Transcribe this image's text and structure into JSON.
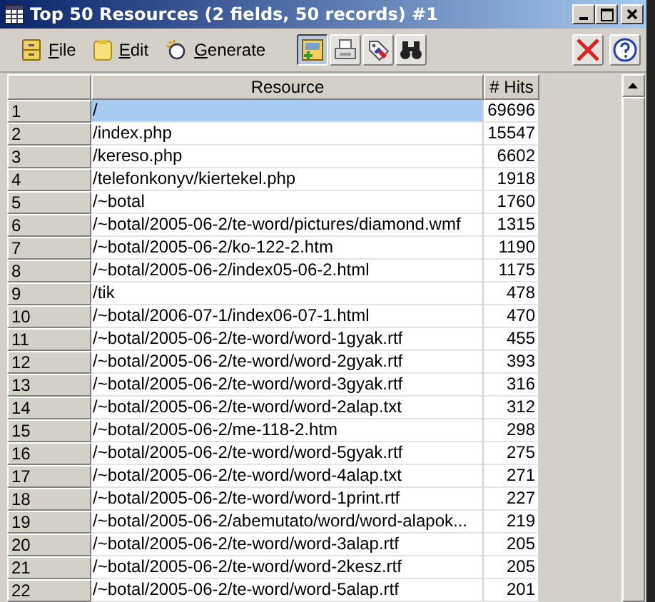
{
  "window": {
    "title": "Top 50 Resources (2 fields, 50 records) #1"
  },
  "menu": [
    {
      "label": "File",
      "kind": "file"
    },
    {
      "label": "Edit",
      "kind": "edit"
    },
    {
      "label": "Generate",
      "kind": "generate"
    }
  ],
  "tools": [
    {
      "kind": "table",
      "selected": true
    },
    {
      "kind": "print",
      "selected": false
    },
    {
      "kind": "tag",
      "selected": false
    },
    {
      "kind": "find",
      "selected": false
    }
  ],
  "table": {
    "columns": [
      "Resource",
      "# Hits"
    ],
    "rows": [
      {
        "index": "1",
        "resource": "/",
        "hits": "69696",
        "selected": true
      },
      {
        "index": "2",
        "resource": "/index.php",
        "hits": "15547",
        "selected": false
      },
      {
        "index": "3",
        "resource": "/kereso.php",
        "hits": "6602",
        "selected": false
      },
      {
        "index": "4",
        "resource": "/telefonkonyv/kiertekel.php",
        "hits": "1918",
        "selected": false
      },
      {
        "index": "5",
        "resource": "/~botal",
        "hits": "1760",
        "selected": false
      },
      {
        "index": "6",
        "resource": "/~botal/2005-06-2/te-word/pictures/diamond.wmf",
        "hits": "1315",
        "selected": false
      },
      {
        "index": "7",
        "resource": "/~botal/2005-06-2/ko-122-2.htm",
        "hits": "1190",
        "selected": false
      },
      {
        "index": "8",
        "resource": "/~botal/2005-06-2/index05-06-2.html",
        "hits": "1175",
        "selected": false
      },
      {
        "index": "9",
        "resource": "/tik",
        "hits": "478",
        "selected": false
      },
      {
        "index": "10",
        "resource": "/~botal/2006-07-1/index06-07-1.html",
        "hits": "470",
        "selected": false
      },
      {
        "index": "11",
        "resource": "/~botal/2005-06-2/te-word/word-1gyak.rtf",
        "hits": "455",
        "selected": false
      },
      {
        "index": "12",
        "resource": "/~botal/2005-06-2/te-word/word-2gyak.rtf",
        "hits": "393",
        "selected": false
      },
      {
        "index": "13",
        "resource": "/~botal/2005-06-2/te-word/word-3gyak.rtf",
        "hits": "316",
        "selected": false
      },
      {
        "index": "14",
        "resource": "/~botal/2005-06-2/te-word/word-2alap.txt",
        "hits": "312",
        "selected": false
      },
      {
        "index": "15",
        "resource": "/~botal/2005-06-2/me-118-2.htm",
        "hits": "298",
        "selected": false
      },
      {
        "index": "16",
        "resource": "/~botal/2005-06-2/te-word/word-5gyak.rtf",
        "hits": "275",
        "selected": false
      },
      {
        "index": "17",
        "resource": "/~botal/2005-06-2/te-word/word-4alap.txt",
        "hits": "271",
        "selected": false
      },
      {
        "index": "18",
        "resource": "/~botal/2005-06-2/te-word/word-1print.rtf",
        "hits": "227",
        "selected": false
      },
      {
        "index": "19",
        "resource": "/~botal/2005-06-2/abemutato/word/word-alapok...",
        "hits": "219",
        "selected": false
      },
      {
        "index": "20",
        "resource": "/~botal/2005-06-2/te-word/word-3alap.rtf",
        "hits": "205",
        "selected": false
      },
      {
        "index": "21",
        "resource": "/~botal/2005-06-2/te-word/word-2kesz.rtf",
        "hits": "205",
        "selected": false
      },
      {
        "index": "22",
        "resource": "/~botal/2005-06-2/te-word/word-5alap.rtf",
        "hits": "201",
        "selected": false
      }
    ]
  }
}
